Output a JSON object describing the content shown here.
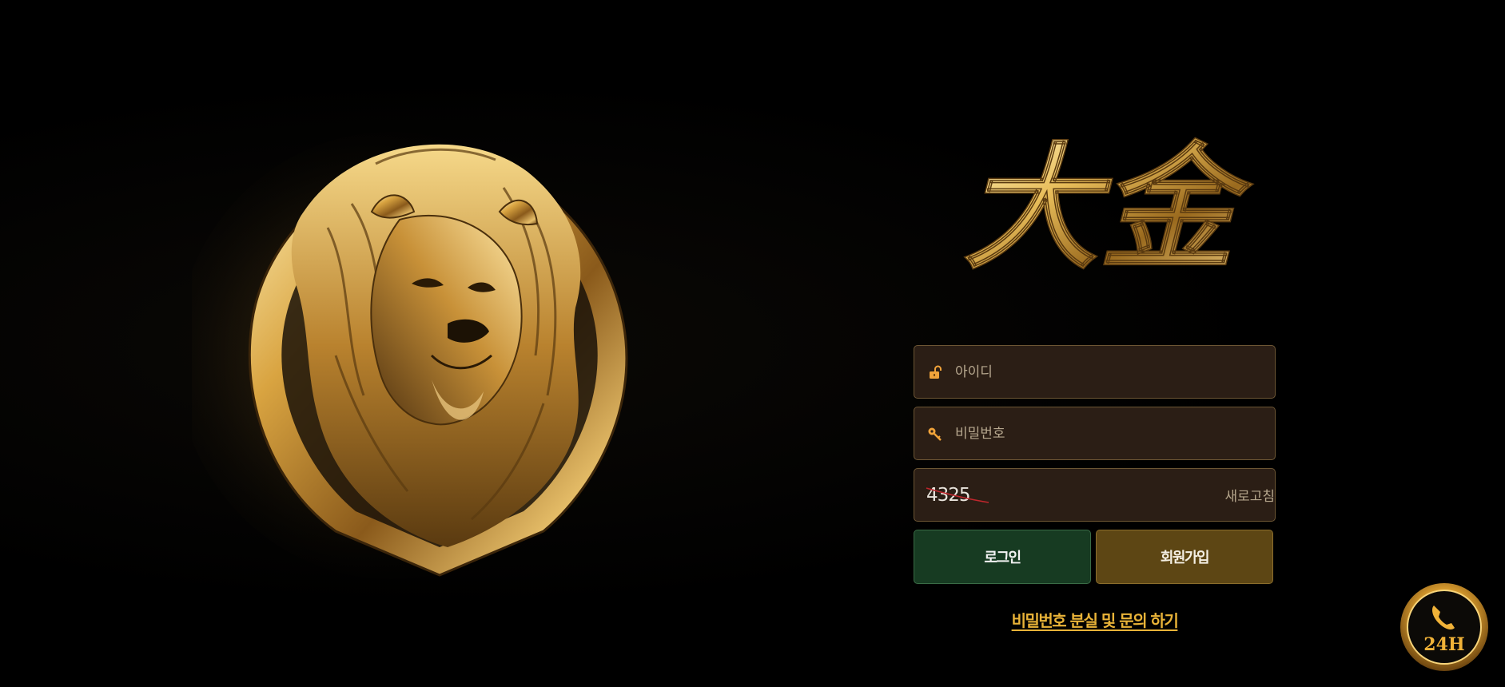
{
  "brand": {
    "logo_text": "大金"
  },
  "login_form": {
    "username_placeholder": "아이디",
    "password_placeholder": "비밀번호",
    "captcha_code": "4325",
    "captcha_input_value": "",
    "refresh_label": "새로고침",
    "login_label": "로그인",
    "signup_label": "회원가입",
    "help_link": "비밀번호 분실 및 문의 하기"
  },
  "support_badge": {
    "label": "24H",
    "icon": "phone-icon"
  },
  "colors": {
    "background": "#000000",
    "field_bg": "#2b1e15",
    "field_border": "#6d5634",
    "gold": "#e9b338",
    "login_button": "#173b22",
    "signup_button": "#5d4614"
  }
}
